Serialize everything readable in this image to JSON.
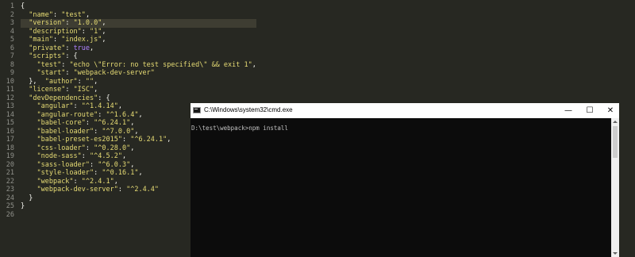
{
  "editor": {
    "line_numbers": [
      "1",
      "2",
      "3",
      "4",
      "5",
      "6",
      "7",
      "8",
      "9",
      "10",
      "11",
      "12",
      "13",
      "14",
      "15",
      "16",
      "17",
      "18",
      "19",
      "20",
      "21",
      "22",
      "23",
      "24",
      "25",
      "26"
    ],
    "lines": [
      "{",
      "  \"name\": \"test\",",
      "  \"version\": \"1.0.0\",",
      "  \"description\": \"1\",",
      "  \"main\": \"index.js\",",
      "  \"private\": true,",
      "  \"scripts\": {",
      "    \"test\": \"echo \\\"Error: no test specified\\\" && exit 1\",",
      "    \"start\": \"webpack-dev-server\"",
      "  },  \"author\": \"\",",
      "  \"license\": \"ISC\",",
      "  \"devDependencies\": {",
      "    \"angular\": \"^1.4.14\",",
      "    \"angular-route\": \"^1.6.4\",",
      "    \"babel-core\": \"^6.24.1\",",
      "    \"babel-loader\": \"^7.0.0\",",
      "    \"babel-preset-es2015\": \"^6.24.1\",",
      "    \"css-loader\": \"^0.28.0\",",
      "    \"node-sass\": \"^4.5.2\",",
      "    \"sass-loader\": \"^6.0.3\",",
      "    \"style-loader\": \"^0.16.1\",",
      "    \"webpack\": \"^2.4.1\",",
      "    \"webpack-dev-server\": \"^2.4.4\"",
      "  }",
      "}",
      ""
    ],
    "current_line": 3
  },
  "cmd": {
    "title": "C:\\Windows\\system32\\cmd.exe",
    "minimize_glyph": "—",
    "maximize_glyph": "☐",
    "close_glyph": "✕",
    "prompt": "D:\\test\\webpack>npm install"
  },
  "colors": {
    "editor_bg": "#272822",
    "string": "#e6db74",
    "boolean": "#ae81ff",
    "text": "#f8f8f2",
    "console_bg": "#0c0c0c",
    "console_text": "#c0c0c0"
  },
  "icons": {
    "cmd_app": "cmd-app-icon"
  }
}
